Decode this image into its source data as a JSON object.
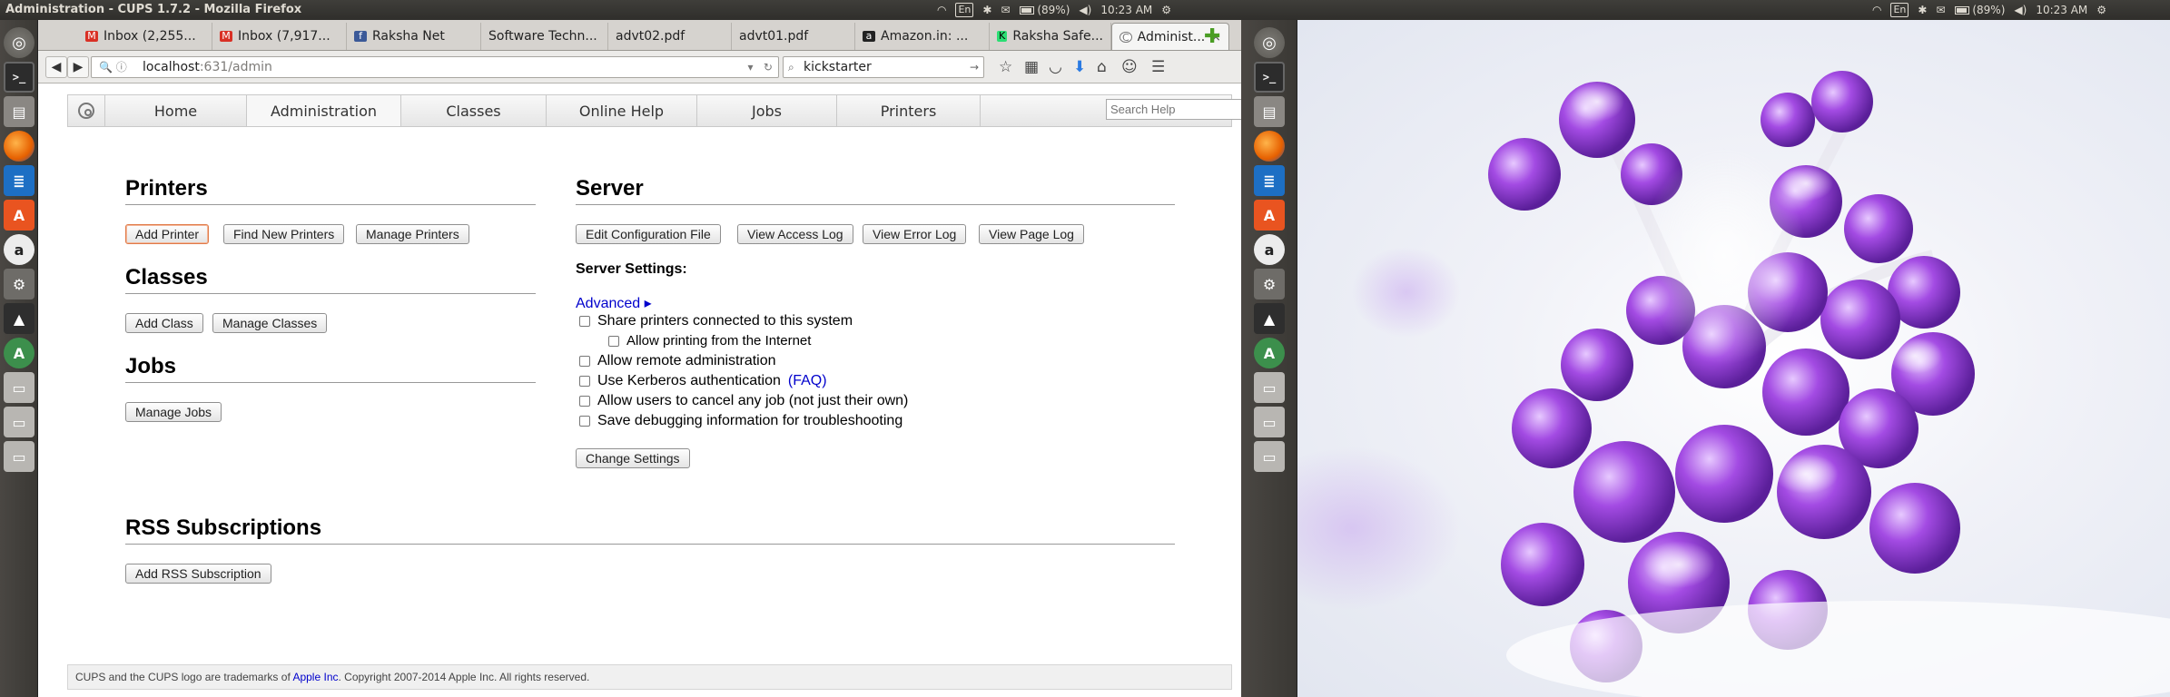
{
  "left_screen": {
    "panel": {
      "title": "Administration - CUPS 1.7.2 - Mozilla Firefox",
      "keyboard": "En",
      "battery": "(89%)",
      "time": "10:23 AM"
    },
    "launcher": [
      {
        "name": "ubuntu-dash-icon",
        "glyph": "◎"
      },
      {
        "name": "terminal-icon",
        "glyph": ">_"
      },
      {
        "name": "files-icon",
        "glyph": "▤"
      },
      {
        "name": "firefox-icon",
        "glyph": ""
      },
      {
        "name": "writer-icon",
        "glyph": "≣"
      },
      {
        "name": "software-center-icon",
        "glyph": "A"
      },
      {
        "name": "amazon-icon",
        "glyph": "a"
      },
      {
        "name": "system-tools-icon",
        "glyph": "⚙"
      },
      {
        "name": "inkscape-icon",
        "glyph": "▲"
      },
      {
        "name": "arduino-icon",
        "glyph": "A"
      },
      {
        "name": "drive-icon",
        "glyph": "▭"
      },
      {
        "name": "drive-icon",
        "glyph": "▭"
      },
      {
        "name": "drive-icon",
        "glyph": "▭"
      }
    ],
    "tabs": [
      {
        "label": "Inbox (2,255...",
        "icon": "gmail-icon",
        "icon_glyph": "M",
        "icon_color": "#d93025",
        "active": false
      },
      {
        "label": "Inbox (7,917...",
        "icon": "gmail-icon",
        "icon_glyph": "M",
        "icon_color": "#d93025",
        "active": false
      },
      {
        "label": "Raksha Net",
        "icon": "facebook-icon",
        "icon_glyph": "f",
        "icon_color": "#3b5998",
        "active": false
      },
      {
        "label": "Software Techn...",
        "icon": "",
        "icon_glyph": "",
        "icon_color": "",
        "active": false
      },
      {
        "label": "advt02.pdf",
        "icon": "",
        "icon_glyph": "",
        "icon_color": "",
        "active": false
      },
      {
        "label": "advt01.pdf",
        "icon": "",
        "icon_glyph": "",
        "icon_color": "",
        "active": false
      },
      {
        "label": "Amazon.in: ...",
        "icon": "amazon-icon",
        "icon_glyph": "a",
        "icon_color": "#222222",
        "active": false
      },
      {
        "label": "Raksha Safe...",
        "icon": "kickstarter-icon",
        "icon_glyph": "K",
        "icon_color": "#2bde73",
        "active": false
      },
      {
        "label": "Administ...",
        "icon": "cups-icon",
        "icon_glyph": "C",
        "icon_color": "#777777",
        "active": true
      }
    ],
    "url": {
      "host": "localhost",
      "path": ":631/admin"
    },
    "search": {
      "value": "kickstarter"
    },
    "cups_nav": [
      "Home",
      "Administration",
      "Classes",
      "Online Help",
      "Jobs",
      "Printers"
    ],
    "search_help_placeholder": "Search Help",
    "printers": {
      "title": "Printers",
      "buttons": [
        "Add Printer",
        "Find New Printers",
        "Manage Printers"
      ]
    },
    "classes": {
      "title": "Classes",
      "buttons": [
        "Add Class",
        "Manage Classes"
      ]
    },
    "jobs": {
      "title": "Jobs",
      "buttons": [
        "Manage Jobs"
      ]
    },
    "server": {
      "title": "Server",
      "buttons": [
        "Edit Configuration File",
        "View Access Log",
        "View Error Log",
        "View Page Log"
      ],
      "settings_label": "Server Settings:",
      "advanced": "Advanced ▸",
      "options": [
        {
          "label": "Share printers connected to this system",
          "checked": false
        },
        {
          "label": "Allow printing from the Internet",
          "checked": false
        },
        {
          "label": "Allow remote administration",
          "checked": false
        },
        {
          "label": "Use Kerberos authentication",
          "checked": false
        },
        {
          "label": "Allow users to cancel any job (not just their own)",
          "checked": false
        },
        {
          "label": "Save debugging information for troubleshooting",
          "checked": false
        }
      ],
      "faq": "(FAQ)",
      "change_button": "Change Settings"
    },
    "rss": {
      "title": "RSS Subscriptions",
      "button": "Add RSS Subscription"
    },
    "footer": {
      "text_before": "CUPS and the CUPS logo are trademarks of ",
      "link": "Apple Inc",
      "text_after": ". Copyright 2007-2014 Apple Inc. All rights reserved."
    }
  },
  "right_screen": {
    "panel": {
      "keyboard": "En",
      "battery": "(89%)",
      "time": "10:23 AM"
    }
  },
  "colors": {
    "panel": "#3c3b37",
    "link": "#0000cc",
    "accent_focus": "#e07a48",
    "berry": "#8a3fd1"
  }
}
